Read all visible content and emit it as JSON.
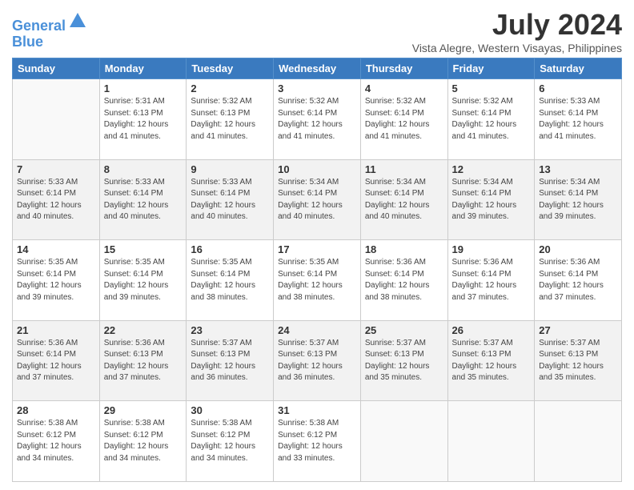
{
  "header": {
    "logo_line1": "General",
    "logo_line2": "Blue",
    "month_year": "July 2024",
    "location": "Vista Alegre, Western Visayas, Philippines"
  },
  "days_of_week": [
    "Sunday",
    "Monday",
    "Tuesday",
    "Wednesday",
    "Thursday",
    "Friday",
    "Saturday"
  ],
  "weeks": [
    [
      {
        "day": "",
        "info": ""
      },
      {
        "day": "1",
        "info": "Sunrise: 5:31 AM\nSunset: 6:13 PM\nDaylight: 12 hours\nand 41 minutes."
      },
      {
        "day": "2",
        "info": "Sunrise: 5:32 AM\nSunset: 6:13 PM\nDaylight: 12 hours\nand 41 minutes."
      },
      {
        "day": "3",
        "info": "Sunrise: 5:32 AM\nSunset: 6:14 PM\nDaylight: 12 hours\nand 41 minutes."
      },
      {
        "day": "4",
        "info": "Sunrise: 5:32 AM\nSunset: 6:14 PM\nDaylight: 12 hours\nand 41 minutes."
      },
      {
        "day": "5",
        "info": "Sunrise: 5:32 AM\nSunset: 6:14 PM\nDaylight: 12 hours\nand 41 minutes."
      },
      {
        "day": "6",
        "info": "Sunrise: 5:33 AM\nSunset: 6:14 PM\nDaylight: 12 hours\nand 41 minutes."
      }
    ],
    [
      {
        "day": "7",
        "info": "Sunrise: 5:33 AM\nSunset: 6:14 PM\nDaylight: 12 hours\nand 40 minutes."
      },
      {
        "day": "8",
        "info": "Sunrise: 5:33 AM\nSunset: 6:14 PM\nDaylight: 12 hours\nand 40 minutes."
      },
      {
        "day": "9",
        "info": "Sunrise: 5:33 AM\nSunset: 6:14 PM\nDaylight: 12 hours\nand 40 minutes."
      },
      {
        "day": "10",
        "info": "Sunrise: 5:34 AM\nSunset: 6:14 PM\nDaylight: 12 hours\nand 40 minutes."
      },
      {
        "day": "11",
        "info": "Sunrise: 5:34 AM\nSunset: 6:14 PM\nDaylight: 12 hours\nand 40 minutes."
      },
      {
        "day": "12",
        "info": "Sunrise: 5:34 AM\nSunset: 6:14 PM\nDaylight: 12 hours\nand 39 minutes."
      },
      {
        "day": "13",
        "info": "Sunrise: 5:34 AM\nSunset: 6:14 PM\nDaylight: 12 hours\nand 39 minutes."
      }
    ],
    [
      {
        "day": "14",
        "info": "Sunrise: 5:35 AM\nSunset: 6:14 PM\nDaylight: 12 hours\nand 39 minutes."
      },
      {
        "day": "15",
        "info": "Sunrise: 5:35 AM\nSunset: 6:14 PM\nDaylight: 12 hours\nand 39 minutes."
      },
      {
        "day": "16",
        "info": "Sunrise: 5:35 AM\nSunset: 6:14 PM\nDaylight: 12 hours\nand 38 minutes."
      },
      {
        "day": "17",
        "info": "Sunrise: 5:35 AM\nSunset: 6:14 PM\nDaylight: 12 hours\nand 38 minutes."
      },
      {
        "day": "18",
        "info": "Sunrise: 5:36 AM\nSunset: 6:14 PM\nDaylight: 12 hours\nand 38 minutes."
      },
      {
        "day": "19",
        "info": "Sunrise: 5:36 AM\nSunset: 6:14 PM\nDaylight: 12 hours\nand 37 minutes."
      },
      {
        "day": "20",
        "info": "Sunrise: 5:36 AM\nSunset: 6:14 PM\nDaylight: 12 hours\nand 37 minutes."
      }
    ],
    [
      {
        "day": "21",
        "info": "Sunrise: 5:36 AM\nSunset: 6:14 PM\nDaylight: 12 hours\nand 37 minutes."
      },
      {
        "day": "22",
        "info": "Sunrise: 5:36 AM\nSunset: 6:13 PM\nDaylight: 12 hours\nand 37 minutes."
      },
      {
        "day": "23",
        "info": "Sunrise: 5:37 AM\nSunset: 6:13 PM\nDaylight: 12 hours\nand 36 minutes."
      },
      {
        "day": "24",
        "info": "Sunrise: 5:37 AM\nSunset: 6:13 PM\nDaylight: 12 hours\nand 36 minutes."
      },
      {
        "day": "25",
        "info": "Sunrise: 5:37 AM\nSunset: 6:13 PM\nDaylight: 12 hours\nand 35 minutes."
      },
      {
        "day": "26",
        "info": "Sunrise: 5:37 AM\nSunset: 6:13 PM\nDaylight: 12 hours\nand 35 minutes."
      },
      {
        "day": "27",
        "info": "Sunrise: 5:37 AM\nSunset: 6:13 PM\nDaylight: 12 hours\nand 35 minutes."
      }
    ],
    [
      {
        "day": "28",
        "info": "Sunrise: 5:38 AM\nSunset: 6:12 PM\nDaylight: 12 hours\nand 34 minutes."
      },
      {
        "day": "29",
        "info": "Sunrise: 5:38 AM\nSunset: 6:12 PM\nDaylight: 12 hours\nand 34 minutes."
      },
      {
        "day": "30",
        "info": "Sunrise: 5:38 AM\nSunset: 6:12 PM\nDaylight: 12 hours\nand 34 minutes."
      },
      {
        "day": "31",
        "info": "Sunrise: 5:38 AM\nSunset: 6:12 PM\nDaylight: 12 hours\nand 33 minutes."
      },
      {
        "day": "",
        "info": ""
      },
      {
        "day": "",
        "info": ""
      },
      {
        "day": "",
        "info": ""
      }
    ]
  ]
}
